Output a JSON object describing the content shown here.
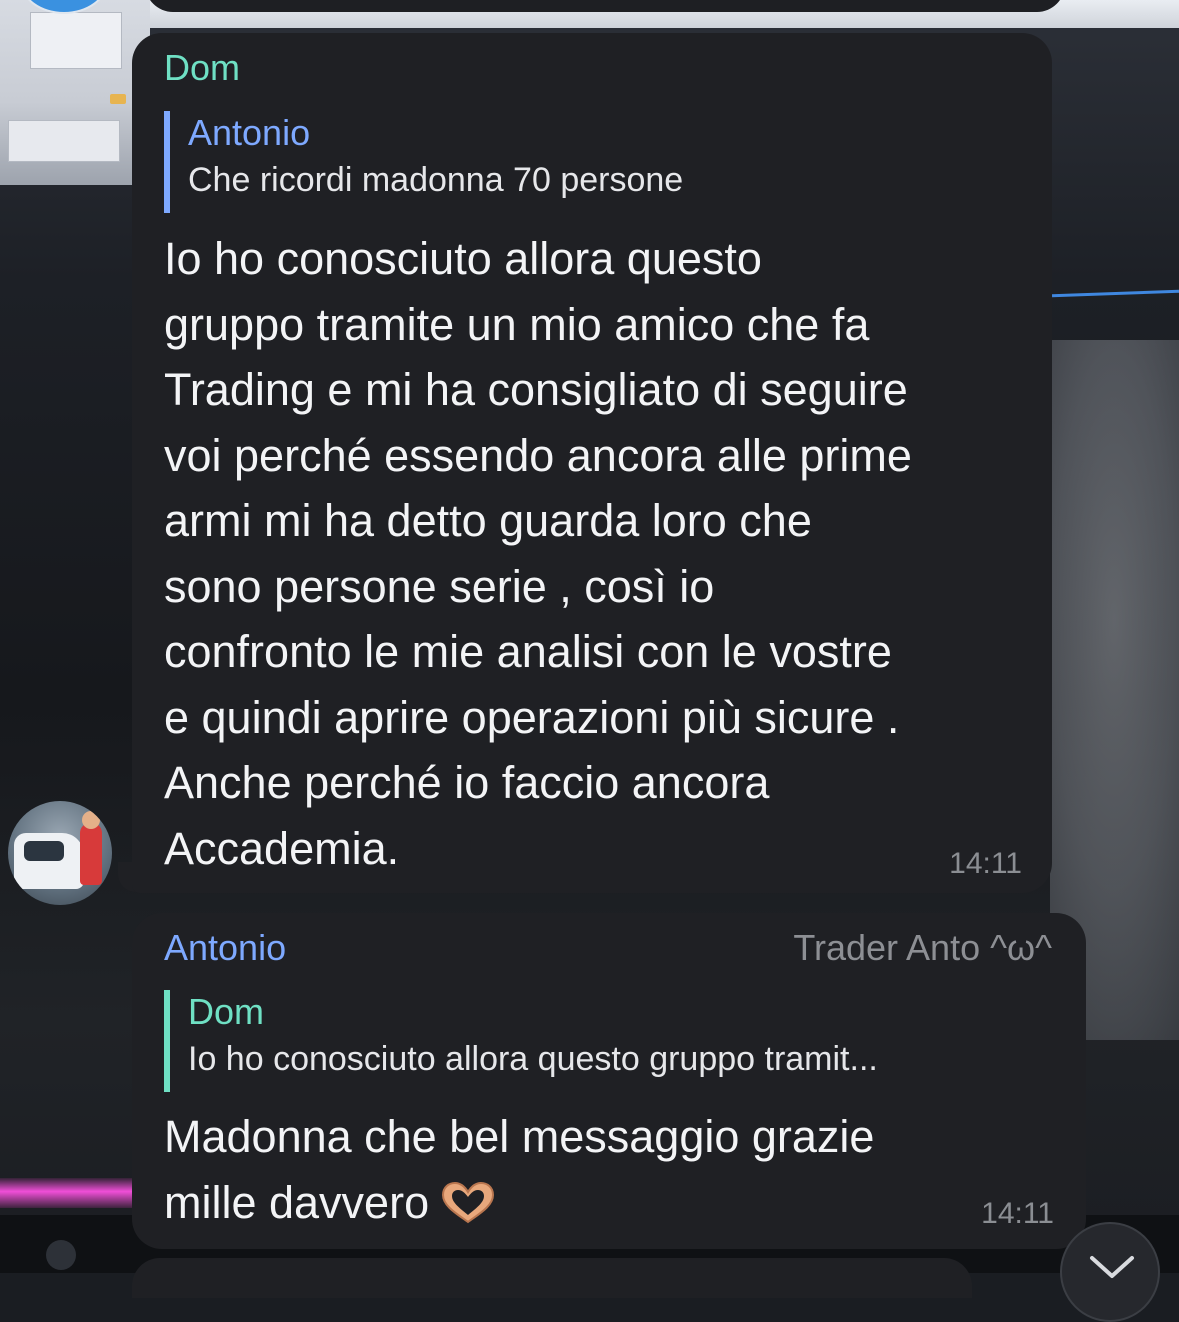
{
  "messages": [
    {
      "sender": "Dom",
      "reply_to": {
        "name": "Antonio",
        "text": "Che ricordi madonna 70 persone"
      },
      "text": "Io ho conosciuto allora questo\ngruppo tramite un mio amico che fa\nTrading e mi ha consigliato di seguire\nvoi perché essendo ancora alle prime\narmi mi ha detto guarda loro che\nsono persone serie  , così io\nconfronto le mie analisi con le vostre\ne quindi aprire operazioni più sicure .\nAnche perché io faccio ancora\nAccademia.",
      "time": "14:11"
    },
    {
      "sender": "Antonio",
      "admin_title": "Trader Anto ^ω^",
      "reply_to": {
        "name": "Dom",
        "text": "Io ho conosciuto allora questo gruppo tramit..."
      },
      "text": "Madonna che bel messaggio grazie\nmille davvero",
      "emoji": "heart-hands",
      "time": "14:11"
    }
  ],
  "colors": {
    "bubble": "#1f2024",
    "dom_name": "#6fe0c4",
    "antonio_name": "#7ea9ff",
    "text": "#f3f4f6",
    "meta": "#8b8e93"
  }
}
